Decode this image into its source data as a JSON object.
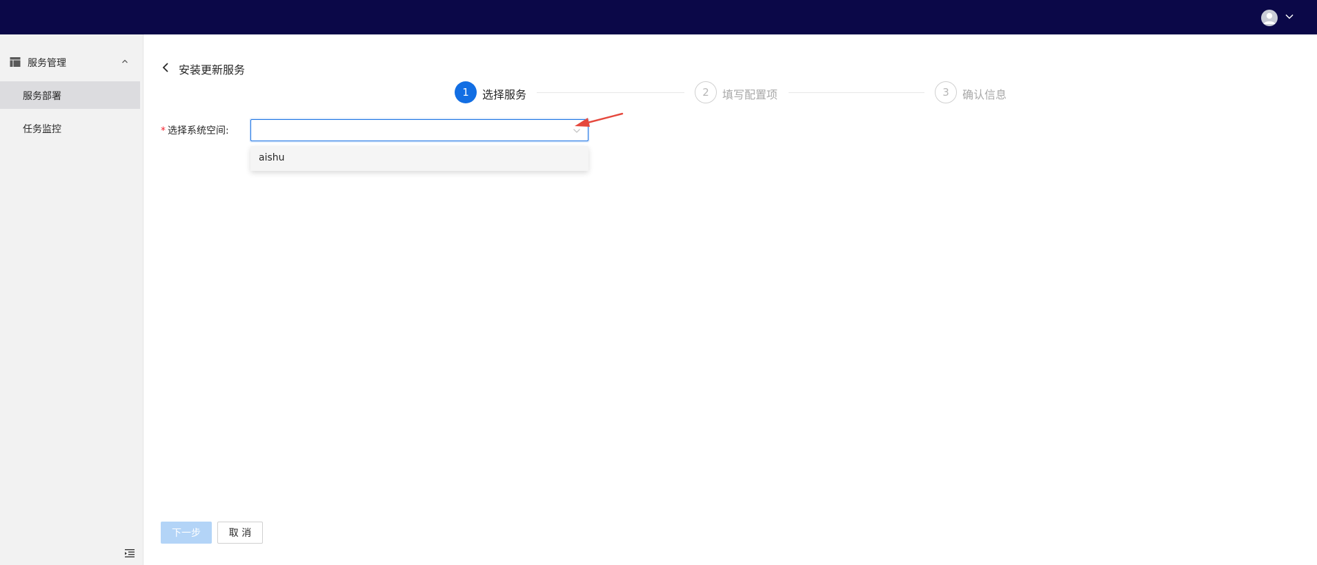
{
  "sidebar": {
    "group_label": "服务管理",
    "items": [
      {
        "label": "服务部署",
        "active": true
      },
      {
        "label": "任务监控",
        "active": false
      }
    ]
  },
  "page": {
    "title": "安装更新服务"
  },
  "steps": [
    {
      "number": "1",
      "title": "选择服务",
      "status": "active"
    },
    {
      "number": "2",
      "title": "填写配置项",
      "status": "wait"
    },
    {
      "number": "3",
      "title": "确认信息",
      "status": "wait"
    }
  ],
  "form": {
    "required_mark": "*",
    "label": "选择系统空间:",
    "select_value": "",
    "options": [
      "aishu"
    ]
  },
  "buttons": {
    "next": "下一步",
    "cancel": "取 消"
  },
  "colors": {
    "topbar": "#0b0848",
    "primary": "#126ee3",
    "annotation": "#e5483d"
  },
  "icons": {
    "user": "user-avatar-icon",
    "group": "layout-icon",
    "back": "chevron-left-icon",
    "collapse": "menu-fold-icon"
  }
}
